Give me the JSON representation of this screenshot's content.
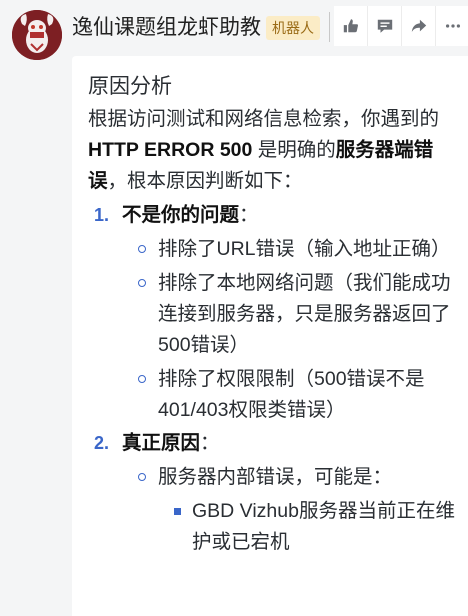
{
  "header": {
    "name": "逸仙课题组龙虾助教",
    "badge": "机器人",
    "actions": [
      {
        "icon": "thumbs-up-icon"
      },
      {
        "icon": "comment-icon"
      },
      {
        "icon": "share-icon"
      },
      {
        "icon": "more-icon"
      }
    ]
  },
  "message": {
    "heading": "原因分析",
    "intro_pre": "根据访问测试和网络信息检索，你遇到的 ",
    "intro_error": "HTTP ERROR 500",
    "intro_mid": " 是明确的",
    "intro_bold": "服务器端错误",
    "intro_post": "，根本原因判断如下：",
    "points": [
      {
        "num": "1.",
        "title": "不是你的问题",
        "colon": "：",
        "subs": [
          "排除了URL错误（输入地址正确）",
          "排除了本地网络问题（我们能成功连接到服务器，只是服务器返回了500错误）",
          "排除了权限限制（500错误不是401/403权限类错误）"
        ]
      },
      {
        "num": "2.",
        "title": "真正原因",
        "colon": "：",
        "subs": [
          "服务器内部错误，可能是："
        ],
        "sub2": [
          "GBD Vizhub服务器当前正在维护或已宕机"
        ]
      }
    ]
  },
  "colors": {
    "accent": "#3a66c9",
    "badge_bg": "#fbecc6",
    "badge_text": "#9a6b16",
    "avatar_bg": "#7d1f23"
  }
}
